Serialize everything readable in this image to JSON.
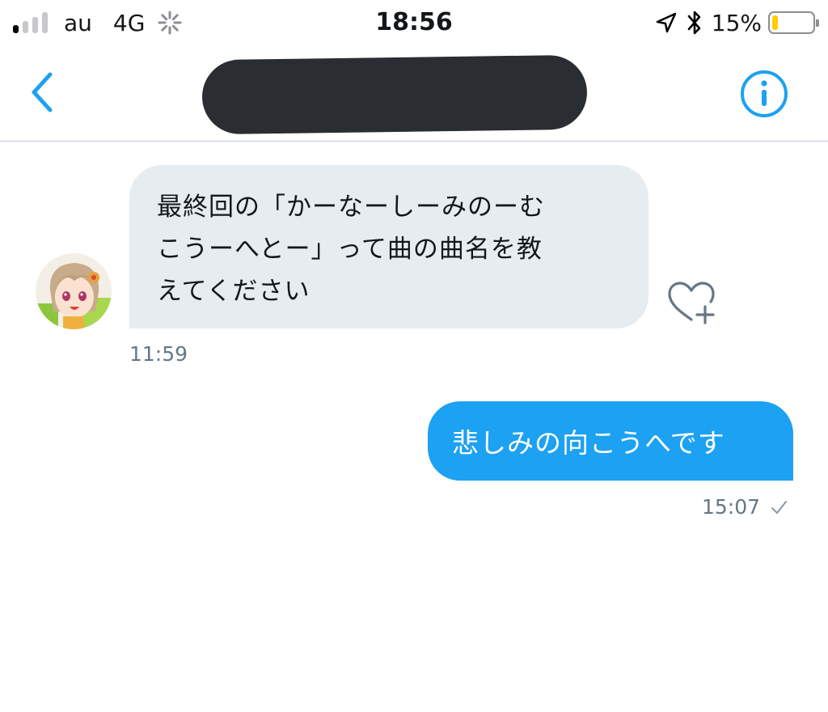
{
  "status_bar": {
    "carrier": "au",
    "network": "4G",
    "time": "18:56",
    "battery_percent": "15%",
    "battery_level": 0.15,
    "signal_bars_active": 1,
    "signal_bars_total": 4
  },
  "nav": {
    "back_icon": "chevron-left-icon",
    "info_icon": "info-icon",
    "accent_color": "#1da1f2"
  },
  "messages": [
    {
      "direction": "received",
      "text": "最終回の「かーなーしーみのーむ\nこうーへとー」って曲の曲名を教\nえてください",
      "time": "11:59"
    },
    {
      "direction": "sent",
      "text": "悲しみの向こうへです",
      "time": "15:07"
    }
  ],
  "colors": {
    "received_bubble": "#e6ecf0",
    "sent_bubble": "#1da1f2",
    "timestamp": "#657786"
  }
}
